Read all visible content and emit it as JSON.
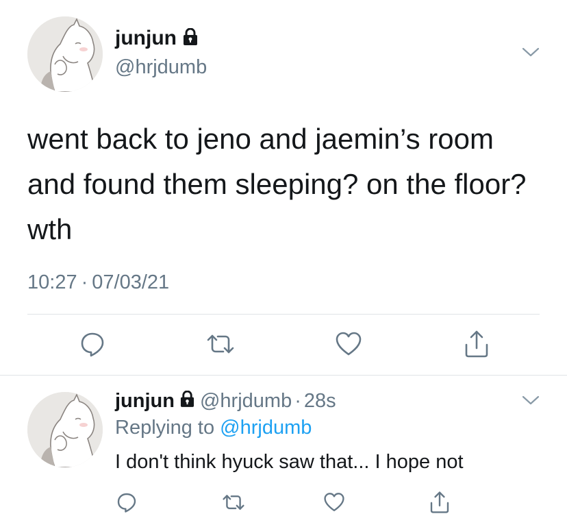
{
  "main_tweet": {
    "display_name": "junjun",
    "handle": "@hrjdumb",
    "text": "went back to jeno and jaemin’s room and found them sleeping? on the floor? wth",
    "time": "10:27",
    "dot": "·",
    "date": "07/03/21"
  },
  "reply": {
    "display_name": "junjun",
    "handle": "@hrjdumb",
    "dot": "·",
    "age": "28s",
    "replying_prefix": "Replying to",
    "replying_handle": "@hrjdumb",
    "text": "I don't think hyuck saw that... I hope not"
  },
  "icons": {
    "lock": "lock-icon",
    "more": "chevron-down-icon",
    "reply": "reply-icon",
    "retweet": "retweet-icon",
    "like": "heart-icon",
    "share": "share-icon"
  },
  "colors": {
    "text": "#14171a",
    "secondary": "#657786",
    "link": "#1da1f2",
    "divider": "#dfe3e6"
  }
}
